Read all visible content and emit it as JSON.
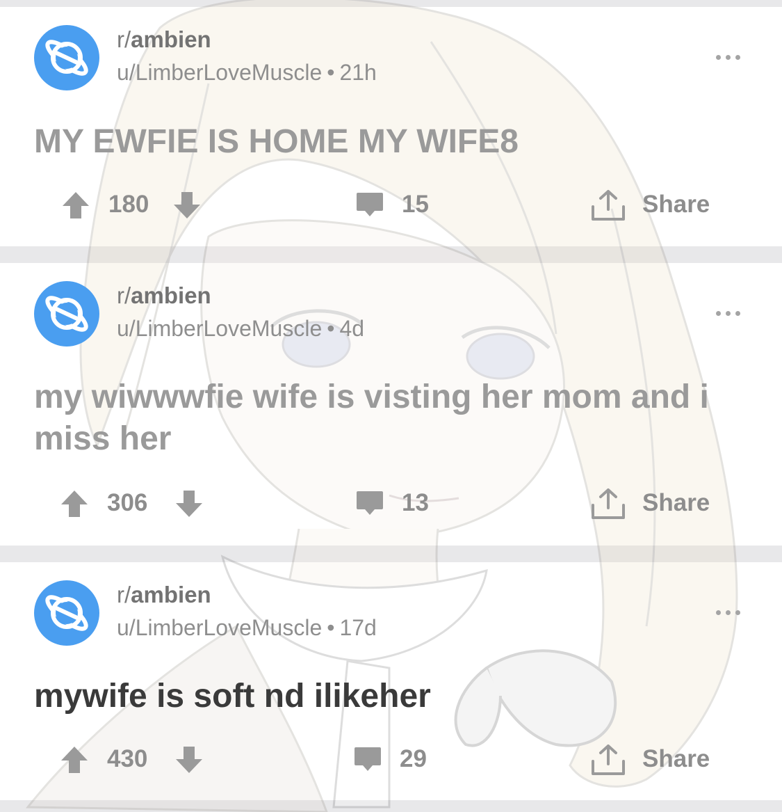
{
  "feed": {
    "posts": [
      {
        "subreddit_prefix": "r/",
        "subreddit": "ambien",
        "author": "u/LimberLoveMuscle",
        "separator": "•",
        "age": "21h",
        "title": "MY EWFIE IS HOME MY WIFE8",
        "upvotes": "180",
        "comments": "15",
        "share_label": "Share"
      },
      {
        "subreddit_prefix": "r/",
        "subreddit": "ambien",
        "author": "u/LimberLoveMuscle",
        "separator": "•",
        "age": "4d",
        "title": "my wiwwwfie wife is visting her mom and i miss her",
        "upvotes": "306",
        "comments": "13",
        "share_label": "Share"
      },
      {
        "subreddit_prefix": "r/",
        "subreddit": "ambien",
        "author": "u/LimberLoveMuscle",
        "separator": "•",
        "age": "17d",
        "title": "mywife is soft nd ilikeher",
        "upvotes": "430",
        "comments": "29",
        "share_label": "Share"
      }
    ]
  },
  "icons": {
    "avatar": "subreddit-planet-icon",
    "more": "more-options-icon",
    "upvote": "upvote-arrow-icon",
    "downvote": "downvote-arrow-icon",
    "comment": "comment-bubble-icon",
    "share": "share-icon"
  },
  "colors": {
    "avatar_blue": "#4a9ef0",
    "divider_gray": "#e8e8ea",
    "muted_text": "#8d8d8d"
  }
}
